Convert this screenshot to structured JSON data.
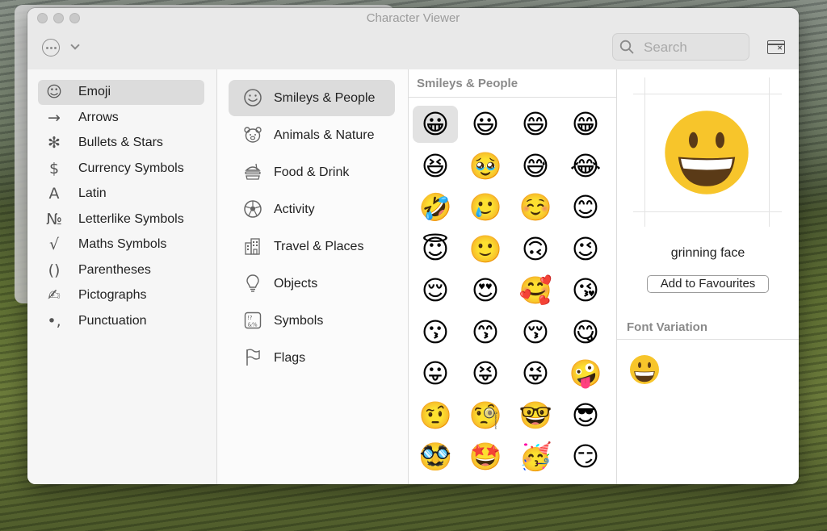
{
  "window": {
    "title": "Character Viewer",
    "search_placeholder": "Search"
  },
  "categories": [
    {
      "label": "Emoji",
      "icon": "smiley-outline-icon",
      "glyph": "☺",
      "selected": true
    },
    {
      "label": "Arrows",
      "icon": "arrow-right-icon",
      "glyph": "→"
    },
    {
      "label": "Bullets & Stars",
      "icon": "asterisk-icon",
      "glyph": "✻"
    },
    {
      "label": "Currency Symbols",
      "icon": "dollar-icon",
      "glyph": "$"
    },
    {
      "label": "Latin",
      "icon": "latin-a-icon",
      "glyph": "A"
    },
    {
      "label": "Letterlike Symbols",
      "icon": "numero-icon",
      "glyph": "№"
    },
    {
      "label": "Maths Symbols",
      "icon": "square-root-icon",
      "glyph": "√"
    },
    {
      "label": "Parentheses",
      "icon": "parentheses-icon",
      "glyph": "()"
    },
    {
      "label": "Pictographs",
      "icon": "pencil-icon",
      "glyph": "✍"
    },
    {
      "label": "Punctuation",
      "icon": "punctuation-icon",
      "glyph": "•,"
    }
  ],
  "groups": [
    {
      "label": "Smileys & People",
      "icon": "smiley-icon",
      "selected": true
    },
    {
      "label": "Animals & Nature",
      "icon": "bear-icon"
    },
    {
      "label": "Food & Drink",
      "icon": "burger-icon"
    },
    {
      "label": "Activity",
      "icon": "soccer-ball-icon"
    },
    {
      "label": "Travel & Places",
      "icon": "building-icon"
    },
    {
      "label": "Objects",
      "icon": "lightbulb-icon"
    },
    {
      "label": "Symbols",
      "icon": "symbols-icon"
    },
    {
      "label": "Flags",
      "icon": "flag-icon"
    }
  ],
  "emoji_section": {
    "title": "Smileys & People",
    "emojis": [
      "😀",
      "😃",
      "😄",
      "😁",
      "😆",
      "🥹",
      "😅",
      "😂",
      "🤣",
      "🥲",
      "☺️",
      "😊",
      "😇",
      "🙂",
      "🙃",
      "😉",
      "😌",
      "😍",
      "🥰",
      "😘",
      "😗",
      "😙",
      "😚",
      "😋",
      "😛",
      "😝",
      "😜",
      "🤪",
      "🤨",
      "🧐",
      "🤓",
      "😎",
      "🥸",
      "🤩",
      "🥳",
      "😏"
    ],
    "selected_index": 0
  },
  "detail": {
    "char_name": "grinning face",
    "add_button": "Add to Favourites",
    "font_variation_title": "Font Variation"
  },
  "colors": {
    "emoji_face": "#f7c52b",
    "selection": "#dcdcdc"
  }
}
